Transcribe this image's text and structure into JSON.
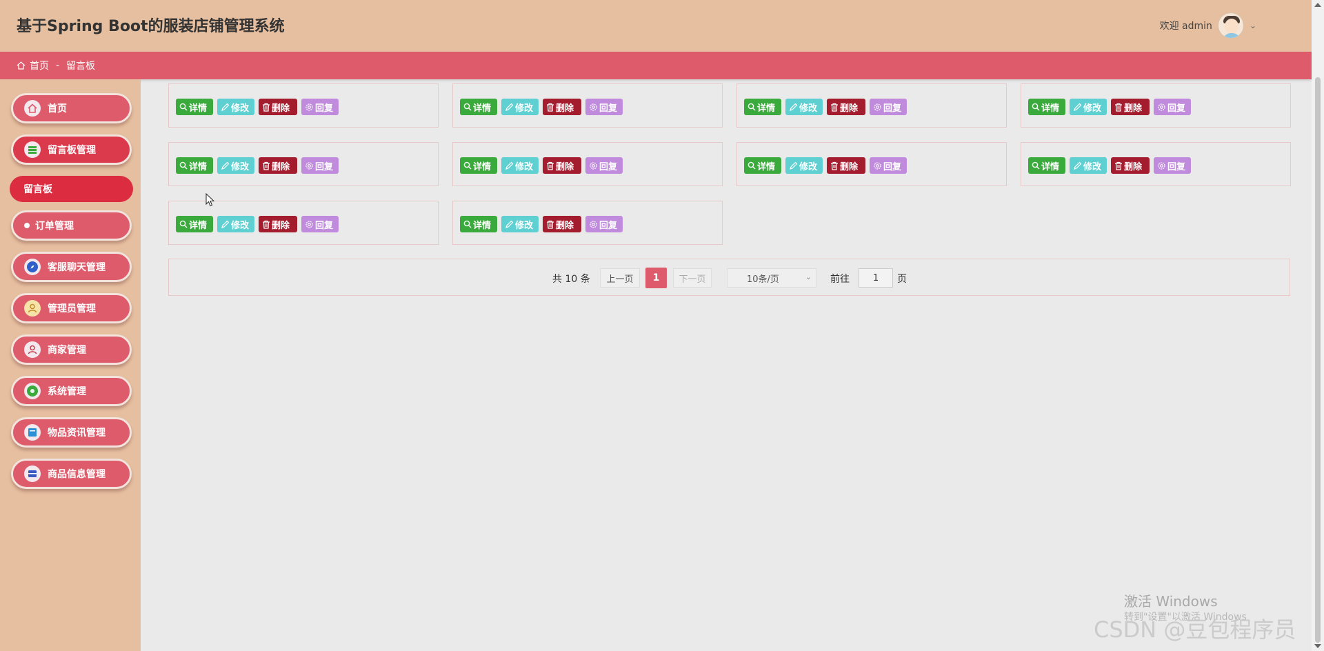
{
  "header": {
    "title": "基于Spring Boot的服装店铺管理系统",
    "welcome": "欢迎 admin"
  },
  "breadcrumb": {
    "home": "首页",
    "separator": "-",
    "current": "留言板"
  },
  "sidebar": {
    "items": [
      {
        "label": "首页",
        "icon": "home-icon"
      },
      {
        "label": "留言板管理",
        "icon": "list-icon"
      },
      {
        "label": "留言板",
        "icon": ""
      },
      {
        "label": "订单管理",
        "icon": "dot-icon"
      },
      {
        "label": "客服聊天管理",
        "icon": "compass-icon"
      },
      {
        "label": "管理员管理",
        "icon": "admin-user-icon"
      },
      {
        "label": "商家管理",
        "icon": "user-icon"
      },
      {
        "label": "系统管理",
        "icon": "settings-icon"
      },
      {
        "label": "物品资讯管理",
        "icon": "news-icon"
      },
      {
        "label": "商品信息管理",
        "icon": "goods-icon"
      }
    ]
  },
  "card_actions": {
    "detail": "详情",
    "edit": "修改",
    "delete": "删除",
    "reply": "回复"
  },
  "cards_count": 10,
  "pagination": {
    "total_text": "共 10 条",
    "prev": "上一页",
    "current_page": "1",
    "next": "下一页",
    "page_size": "10条/页",
    "goto_label": "前往",
    "goto_value": "1",
    "page_unit": "页"
  },
  "watermark": {
    "windows_title": "激活 Windows",
    "windows_sub": "转到\"设置\"以激活 Windows",
    "csdn": "CSDN @豆包程序员"
  },
  "colors": {
    "header_bg": "#e5bf9f",
    "accent": "#dd5b6a",
    "detail": "#3aaa3c",
    "edit": "#5fd0d2",
    "delete": "#a31d2e",
    "reply": "#c08bdd"
  }
}
